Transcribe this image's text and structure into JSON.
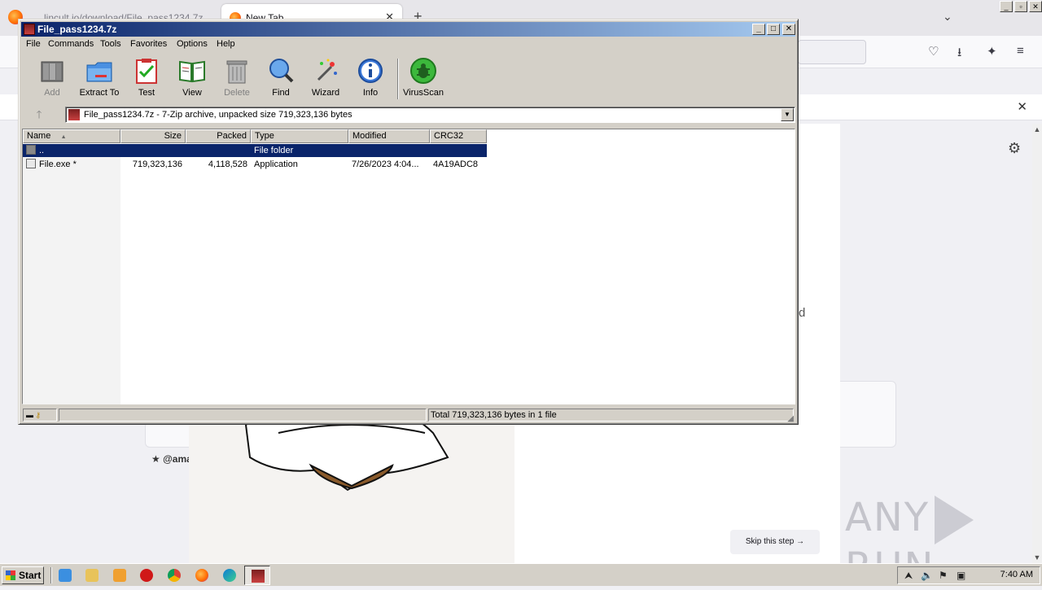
{
  "firefox": {
    "inactive_tab_title": "lincult.io/download/File_pass1234.7z",
    "active_tab_title": "New Tab",
    "tab_close_glyph": "✕",
    "new_tab_glyph": "+",
    "list_tabs_glyph": "⌄",
    "notification_close_glyph": "✕",
    "settings_glyph": "⚙",
    "partial_text": "d",
    "card_handle": "★ @ama",
    "skip_button_label": "Skip this step →",
    "window_controls": [
      "_",
      "▫",
      "✕"
    ]
  },
  "winrar": {
    "title": "File_pass1234.7z",
    "title_controls": [
      "_",
      "□",
      "✕"
    ],
    "menu": [
      "File",
      "Commands",
      "Tools",
      "Favorites",
      "Options",
      "Help"
    ],
    "toolbar": [
      {
        "label": "Add",
        "icon": "add-archive-icon",
        "enabled": false
      },
      {
        "label": "Extract To",
        "icon": "extract-folder-icon",
        "enabled": true
      },
      {
        "label": "Test",
        "icon": "test-clipboard-icon",
        "enabled": true
      },
      {
        "label": "View",
        "icon": "view-book-icon",
        "enabled": true
      },
      {
        "label": "Delete",
        "icon": "delete-bin-icon",
        "enabled": false
      },
      {
        "label": "Find",
        "icon": "find-magnifier-icon",
        "enabled": true
      },
      {
        "label": "Wizard",
        "icon": "wizard-wand-icon",
        "enabled": true
      },
      {
        "label": "Info",
        "icon": "info-icon",
        "enabled": true
      },
      {
        "label": "VirusScan",
        "icon": "virusscan-bug-icon",
        "enabled": true
      }
    ],
    "address": "File_pass1234.7z - 7-Zip archive, unpacked size 719,323,136 bytes",
    "up_glyph": "🡑",
    "dropdown_glyph": "▼",
    "columns": [
      "Name",
      "Size",
      "Packed",
      "Type",
      "Modified",
      "CRC32"
    ],
    "sort_glyph": "▲",
    "rows": [
      {
        "name": "..",
        "size": "",
        "packed": "",
        "type": "File folder",
        "modified": "",
        "crc": "",
        "selected": true
      },
      {
        "name": "File.exe *",
        "size": "719,323,136",
        "packed": "4,118,528",
        "type": "Application",
        "modified": "7/26/2023 4:04...",
        "crc": "4A19ADC8",
        "selected": false
      }
    ],
    "status_total": "Total 719,323,136 bytes in 1 file",
    "grip_glyph": "◢"
  },
  "taskbar": {
    "start_label": "Start",
    "tray_expand_glyph": "⮝",
    "clock": "7:40 AM"
  },
  "watermark": {
    "left": "ANY",
    "right": "RUN"
  },
  "colors": {
    "titlebar_start": "#0a246a",
    "titlebar_end": "#a6caf0",
    "selection": "#0a246a",
    "chrome": "#d4d0c8"
  }
}
